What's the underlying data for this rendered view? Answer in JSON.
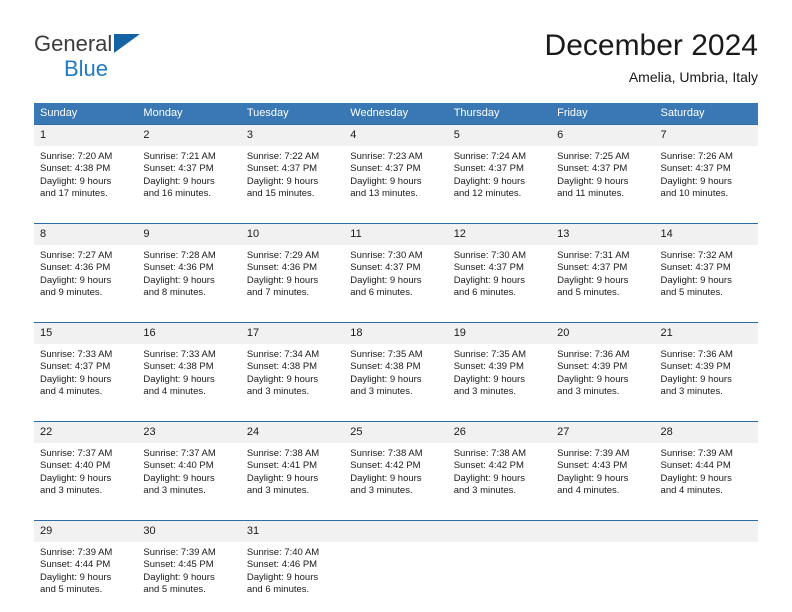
{
  "brand": {
    "line1": "General",
    "line2": "Blue",
    "triangle_color": "#1464a5",
    "line2_color": "#1f7bc4"
  },
  "header": {
    "title": "December 2024",
    "subtitle": "Amelia, Umbria, Italy"
  },
  "theme": {
    "header_bg": "#3978b5",
    "week_border": "#2e6da4",
    "daynum_bg": "#f1f1f1",
    "text": "#1a1a1a"
  },
  "weekdays": [
    "Sunday",
    "Monday",
    "Tuesday",
    "Wednesday",
    "Thursday",
    "Friday",
    "Saturday"
  ],
  "weeks": [
    [
      {
        "day": "1",
        "sunrise": "Sunrise: 7:20 AM",
        "sunset": "Sunset: 4:38 PM",
        "daylight1": "Daylight: 9 hours",
        "daylight2": "and 17 minutes."
      },
      {
        "day": "2",
        "sunrise": "Sunrise: 7:21 AM",
        "sunset": "Sunset: 4:37 PM",
        "daylight1": "Daylight: 9 hours",
        "daylight2": "and 16 minutes."
      },
      {
        "day": "3",
        "sunrise": "Sunrise: 7:22 AM",
        "sunset": "Sunset: 4:37 PM",
        "daylight1": "Daylight: 9 hours",
        "daylight2": "and 15 minutes."
      },
      {
        "day": "4",
        "sunrise": "Sunrise: 7:23 AM",
        "sunset": "Sunset: 4:37 PM",
        "daylight1": "Daylight: 9 hours",
        "daylight2": "and 13 minutes."
      },
      {
        "day": "5",
        "sunrise": "Sunrise: 7:24 AM",
        "sunset": "Sunset: 4:37 PM",
        "daylight1": "Daylight: 9 hours",
        "daylight2": "and 12 minutes."
      },
      {
        "day": "6",
        "sunrise": "Sunrise: 7:25 AM",
        "sunset": "Sunset: 4:37 PM",
        "daylight1": "Daylight: 9 hours",
        "daylight2": "and 11 minutes."
      },
      {
        "day": "7",
        "sunrise": "Sunrise: 7:26 AM",
        "sunset": "Sunset: 4:37 PM",
        "daylight1": "Daylight: 9 hours",
        "daylight2": "and 10 minutes."
      }
    ],
    [
      {
        "day": "8",
        "sunrise": "Sunrise: 7:27 AM",
        "sunset": "Sunset: 4:36 PM",
        "daylight1": "Daylight: 9 hours",
        "daylight2": "and 9 minutes."
      },
      {
        "day": "9",
        "sunrise": "Sunrise: 7:28 AM",
        "sunset": "Sunset: 4:36 PM",
        "daylight1": "Daylight: 9 hours",
        "daylight2": "and 8 minutes."
      },
      {
        "day": "10",
        "sunrise": "Sunrise: 7:29 AM",
        "sunset": "Sunset: 4:36 PM",
        "daylight1": "Daylight: 9 hours",
        "daylight2": "and 7 minutes."
      },
      {
        "day": "11",
        "sunrise": "Sunrise: 7:30 AM",
        "sunset": "Sunset: 4:37 PM",
        "daylight1": "Daylight: 9 hours",
        "daylight2": "and 6 minutes."
      },
      {
        "day": "12",
        "sunrise": "Sunrise: 7:30 AM",
        "sunset": "Sunset: 4:37 PM",
        "daylight1": "Daylight: 9 hours",
        "daylight2": "and 6 minutes."
      },
      {
        "day": "13",
        "sunrise": "Sunrise: 7:31 AM",
        "sunset": "Sunset: 4:37 PM",
        "daylight1": "Daylight: 9 hours",
        "daylight2": "and 5 minutes."
      },
      {
        "day": "14",
        "sunrise": "Sunrise: 7:32 AM",
        "sunset": "Sunset: 4:37 PM",
        "daylight1": "Daylight: 9 hours",
        "daylight2": "and 5 minutes."
      }
    ],
    [
      {
        "day": "15",
        "sunrise": "Sunrise: 7:33 AM",
        "sunset": "Sunset: 4:37 PM",
        "daylight1": "Daylight: 9 hours",
        "daylight2": "and 4 minutes."
      },
      {
        "day": "16",
        "sunrise": "Sunrise: 7:33 AM",
        "sunset": "Sunset: 4:38 PM",
        "daylight1": "Daylight: 9 hours",
        "daylight2": "and 4 minutes."
      },
      {
        "day": "17",
        "sunrise": "Sunrise: 7:34 AM",
        "sunset": "Sunset: 4:38 PM",
        "daylight1": "Daylight: 9 hours",
        "daylight2": "and 3 minutes."
      },
      {
        "day": "18",
        "sunrise": "Sunrise: 7:35 AM",
        "sunset": "Sunset: 4:38 PM",
        "daylight1": "Daylight: 9 hours",
        "daylight2": "and 3 minutes."
      },
      {
        "day": "19",
        "sunrise": "Sunrise: 7:35 AM",
        "sunset": "Sunset: 4:39 PM",
        "daylight1": "Daylight: 9 hours",
        "daylight2": "and 3 minutes."
      },
      {
        "day": "20",
        "sunrise": "Sunrise: 7:36 AM",
        "sunset": "Sunset: 4:39 PM",
        "daylight1": "Daylight: 9 hours",
        "daylight2": "and 3 minutes."
      },
      {
        "day": "21",
        "sunrise": "Sunrise: 7:36 AM",
        "sunset": "Sunset: 4:39 PM",
        "daylight1": "Daylight: 9 hours",
        "daylight2": "and 3 minutes."
      }
    ],
    [
      {
        "day": "22",
        "sunrise": "Sunrise: 7:37 AM",
        "sunset": "Sunset: 4:40 PM",
        "daylight1": "Daylight: 9 hours",
        "daylight2": "and 3 minutes."
      },
      {
        "day": "23",
        "sunrise": "Sunrise: 7:37 AM",
        "sunset": "Sunset: 4:40 PM",
        "daylight1": "Daylight: 9 hours",
        "daylight2": "and 3 minutes."
      },
      {
        "day": "24",
        "sunrise": "Sunrise: 7:38 AM",
        "sunset": "Sunset: 4:41 PM",
        "daylight1": "Daylight: 9 hours",
        "daylight2": "and 3 minutes."
      },
      {
        "day": "25",
        "sunrise": "Sunrise: 7:38 AM",
        "sunset": "Sunset: 4:42 PM",
        "daylight1": "Daylight: 9 hours",
        "daylight2": "and 3 minutes."
      },
      {
        "day": "26",
        "sunrise": "Sunrise: 7:38 AM",
        "sunset": "Sunset: 4:42 PM",
        "daylight1": "Daylight: 9 hours",
        "daylight2": "and 3 minutes."
      },
      {
        "day": "27",
        "sunrise": "Sunrise: 7:39 AM",
        "sunset": "Sunset: 4:43 PM",
        "daylight1": "Daylight: 9 hours",
        "daylight2": "and 4 minutes."
      },
      {
        "day": "28",
        "sunrise": "Sunrise: 7:39 AM",
        "sunset": "Sunset: 4:44 PM",
        "daylight1": "Daylight: 9 hours",
        "daylight2": "and 4 minutes."
      }
    ],
    [
      {
        "day": "29",
        "sunrise": "Sunrise: 7:39 AM",
        "sunset": "Sunset: 4:44 PM",
        "daylight1": "Daylight: 9 hours",
        "daylight2": "and 5 minutes."
      },
      {
        "day": "30",
        "sunrise": "Sunrise: 7:39 AM",
        "sunset": "Sunset: 4:45 PM",
        "daylight1": "Daylight: 9 hours",
        "daylight2": "and 5 minutes."
      },
      {
        "day": "31",
        "sunrise": "Sunrise: 7:40 AM",
        "sunset": "Sunset: 4:46 PM",
        "daylight1": "Daylight: 9 hours",
        "daylight2": "and 6 minutes."
      },
      {
        "day": "",
        "sunrise": "",
        "sunset": "",
        "daylight1": "",
        "daylight2": ""
      },
      {
        "day": "",
        "sunrise": "",
        "sunset": "",
        "daylight1": "",
        "daylight2": ""
      },
      {
        "day": "",
        "sunrise": "",
        "sunset": "",
        "daylight1": "",
        "daylight2": ""
      },
      {
        "day": "",
        "sunrise": "",
        "sunset": "",
        "daylight1": "",
        "daylight2": ""
      }
    ]
  ]
}
